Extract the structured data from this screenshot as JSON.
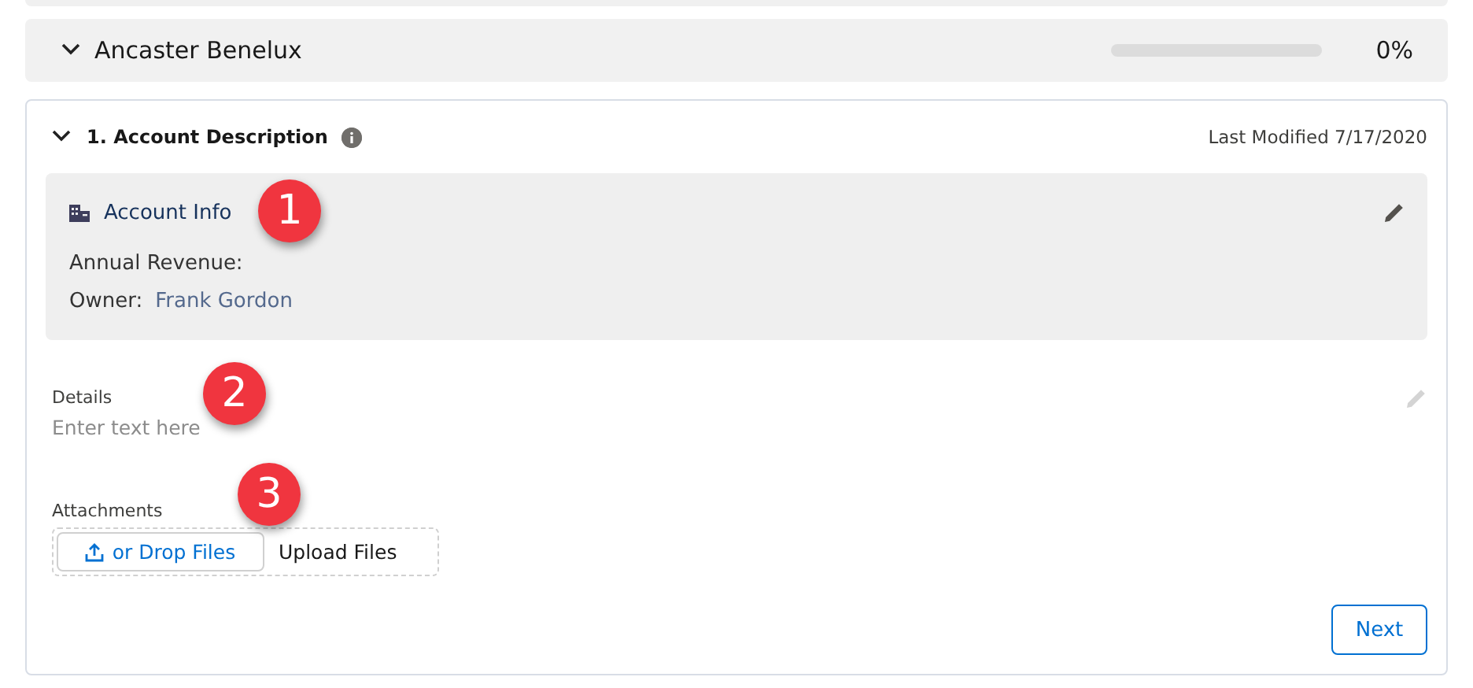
{
  "group": {
    "title": "Ancaster Benelux",
    "expanded": true,
    "progress": {
      "level": 0,
      "reading": "0%"
    }
  },
  "section": {
    "title": "1. Account Description",
    "expanded": true,
    "last_modified": "Last Modified 7/17/2020",
    "account_info": {
      "title": "Account Info",
      "fields": [
        {
          "label": "Annual Revenue:"
        },
        {
          "label": "Owner:",
          "value": "Frank Gordon"
        }
      ]
    },
    "details": {
      "label": "Details",
      "placeholder": "Enter text here"
    },
    "attachments": {
      "label": "Attachments",
      "upload_button": "or Drop Files",
      "upload_text": "Upload Files"
    },
    "next_button": "Next"
  },
  "callouts": [
    "1",
    "2",
    "3"
  ]
}
